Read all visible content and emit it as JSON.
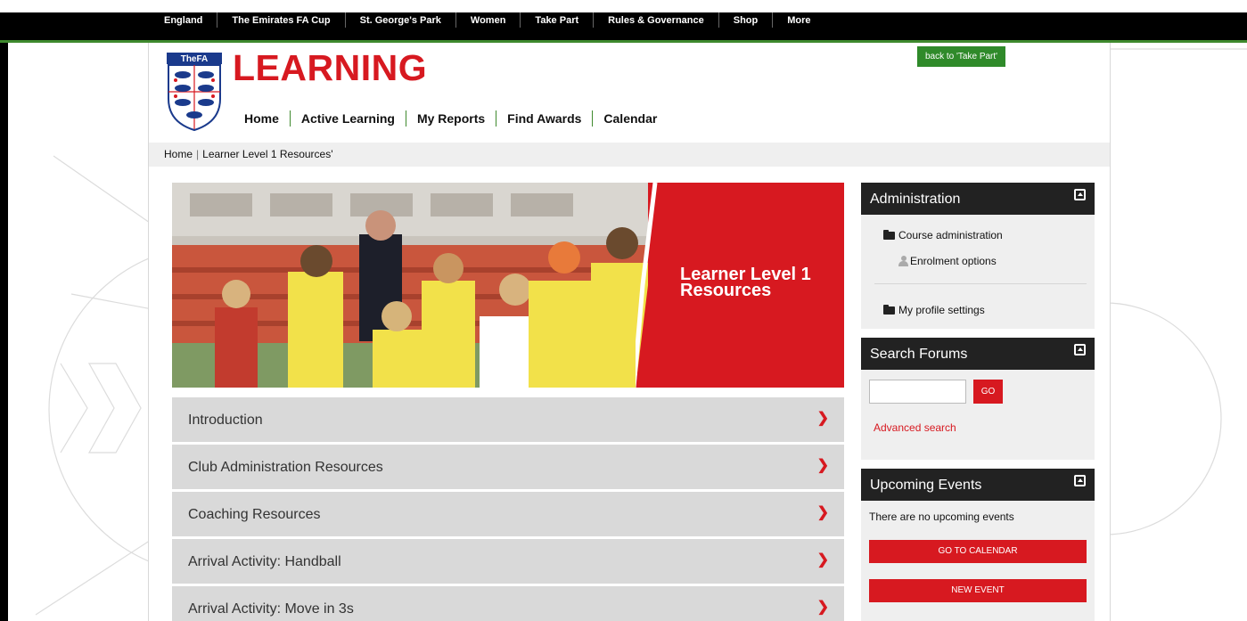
{
  "topnav": [
    "England",
    "The Emirates FA Cup",
    "St. George's Park",
    "Women",
    "Take Part",
    "Rules & Governance",
    "Shop",
    "More"
  ],
  "header": {
    "logo_text": "TheFA",
    "title": "LEARNING",
    "back_button": "back to 'Take Part'"
  },
  "mainnav": [
    "Home",
    "Active Learning",
    "My Reports",
    "Find Awards",
    "Calendar"
  ],
  "breadcrumb": {
    "home": "Home",
    "current": "Learner Level 1 Resources'"
  },
  "hero": {
    "title": "Learner Level 1 Resources"
  },
  "sections": [
    "Introduction",
    "Club Administration Resources",
    "Coaching Resources",
    "Arrival Activity: Handball",
    "Arrival Activity: Move in 3s"
  ],
  "sidebar": {
    "administration": {
      "title": "Administration",
      "course_admin": "Course administration",
      "enrolment": "Enrolment options",
      "profile": "My profile settings"
    },
    "search_forums": {
      "title": "Search Forums",
      "go": "GO",
      "advanced": "Advanced search"
    },
    "upcoming_events": {
      "title": "Upcoming Events",
      "empty": "There are no upcoming events",
      "go_calendar": "GO TO CALENDAR",
      "new_event": "NEW EVENT"
    }
  },
  "colors": {
    "brand_red": "#d71920",
    "brand_green": "#3f8a2e",
    "header_dark": "#222222"
  }
}
